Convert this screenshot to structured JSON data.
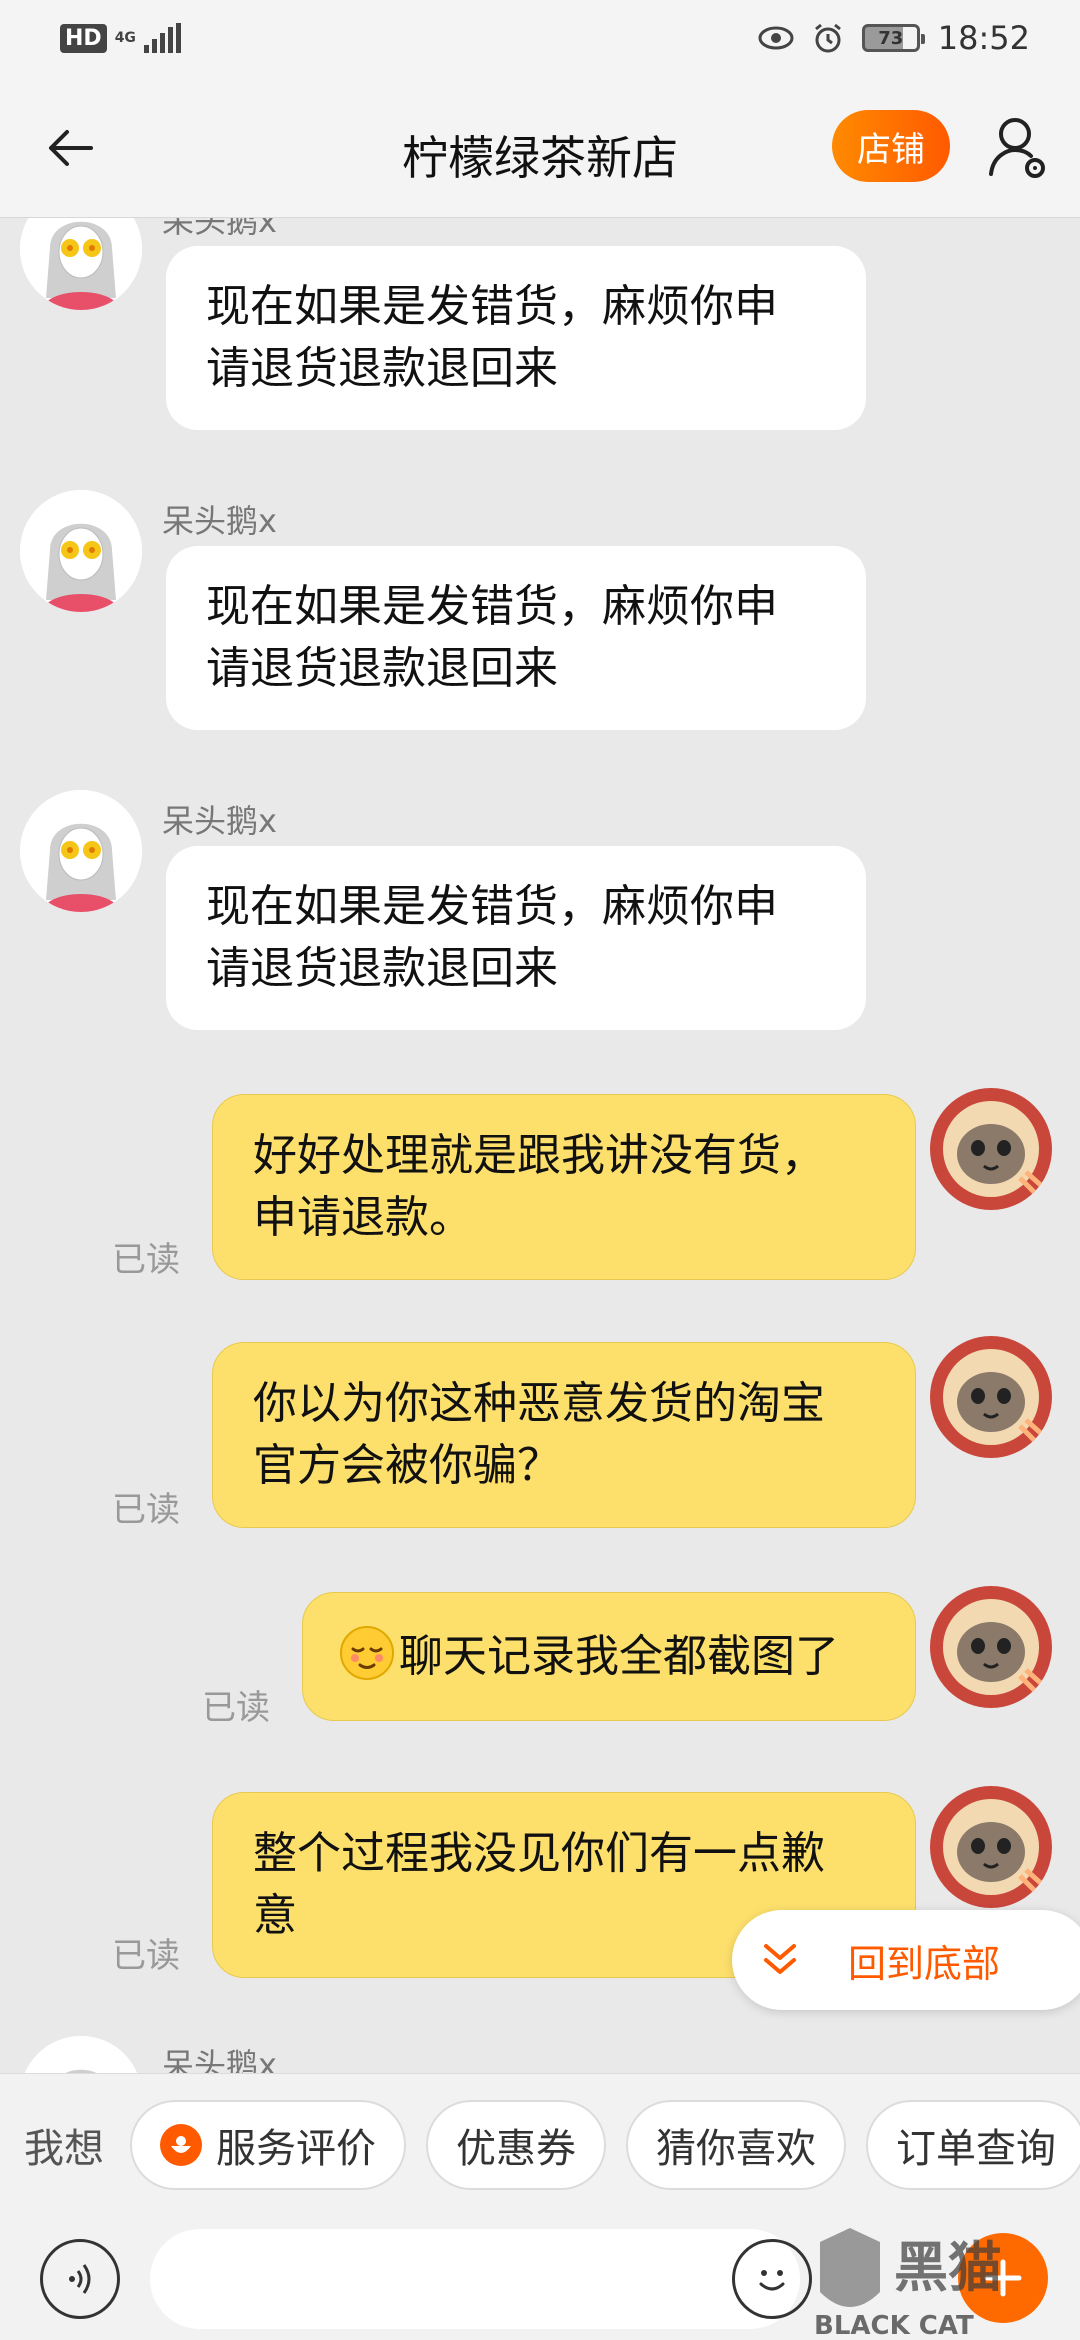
{
  "status_bar": {
    "hd": "HD",
    "network": "4G",
    "battery": "73",
    "time": "18:52"
  },
  "header": {
    "title": "柠檬绿茶新店",
    "shop_button": "店铺"
  },
  "messages": [
    {
      "side": "left",
      "sender": "呆头鹅x",
      "lines": [
        "现在如果是发错货，麻烦你申",
        "请退货退款退回来"
      ]
    },
    {
      "side": "left",
      "sender": "呆头鹅x",
      "lines": [
        "现在如果是发错货，麻烦你申",
        "请退货退款退回来"
      ]
    },
    {
      "side": "left",
      "sender": "呆头鹅x",
      "lines": [
        "现在如果是发错货，麻烦你申",
        "请退货退款退回来"
      ]
    },
    {
      "side": "right",
      "read": "已读",
      "lines": [
        "好好处理就是跟我讲没有货，",
        "申请退款。"
      ]
    },
    {
      "side": "right",
      "read": "已读",
      "lines": [
        "你以为你这种恶意发货的淘宝",
        "官方会被你骗？"
      ]
    },
    {
      "side": "right",
      "read": "已读",
      "emoji": "relieved-face",
      "lines": [
        "聊天记录我全都截图了"
      ]
    },
    {
      "side": "right",
      "read": "已读",
      "lines": [
        "整个过程我没见你们有一点歉",
        "意"
      ]
    },
    {
      "side": "left",
      "sender": "呆头鹅x",
      "lines": []
    }
  ],
  "jump_to_bottom": "回到底部",
  "quick_bar": {
    "label": "我想",
    "chips": [
      "服务评价",
      "优惠券",
      "猜你喜欢",
      "订单查询"
    ]
  },
  "input": {
    "placeholder": ""
  },
  "watermark": {
    "text": "黑猫",
    "subtext": "BLACK CAT"
  },
  "colors": {
    "accent": "#ff5a00",
    "self_bubble": "#fde06c",
    "other_bubble": "#ffffff",
    "chat_bg": "#e9e9e9"
  }
}
